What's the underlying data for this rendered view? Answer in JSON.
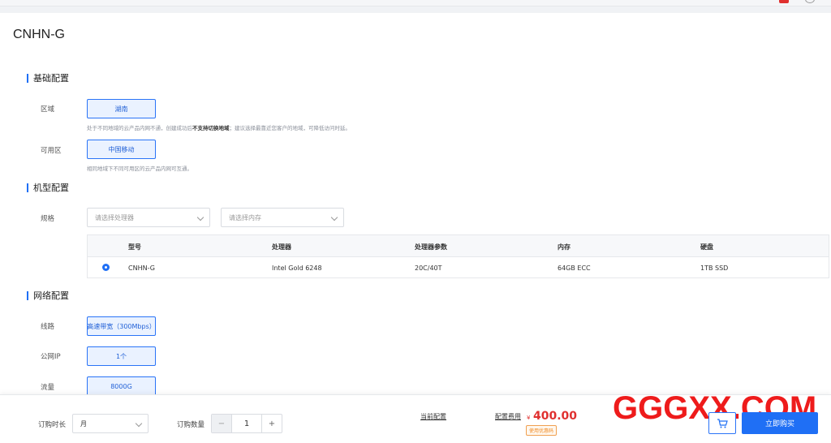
{
  "page": {
    "title": "CNHN-G"
  },
  "sections": {
    "basic": "基础配置",
    "machine": "机型配置",
    "network": "网络配置"
  },
  "region": {
    "label": "区域",
    "option": "湖南",
    "hint_pre": "处于不同地域的云产品内网不通，创建成功后",
    "hint_bold": "不支持切换地域",
    "hint_post": "；建议选择最靠近您客户的地域，可降低访问时延。"
  },
  "zone": {
    "label": "可用区",
    "option": "中国移动",
    "hint": "相同地域下不同可用区的云产品内网可互通。"
  },
  "spec": {
    "label": "规格",
    "cpu_placeholder": "请选择处理器",
    "mem_placeholder": "请选择内存"
  },
  "table": {
    "headers": [
      "型号",
      "处理器",
      "处理器参数",
      "内存",
      "硬盘"
    ],
    "rows": [
      {
        "model": "CNHN-G",
        "cpu": "Intel Gold 6248",
        "cpu_params": "20C/40T",
        "memory": "64GB ECC",
        "disk": "1TB SSD",
        "selected": true
      }
    ]
  },
  "network": {
    "line_label": "线路",
    "line_option": "高速带宽（300Mbps）",
    "ip_label": "公网IP",
    "ip_option": "1个",
    "traffic_label": "流量",
    "traffic_option": "8000G"
  },
  "footer": {
    "duration_label": "订购时长",
    "duration_value": "月",
    "quantity_label": "订购数量",
    "quantity_value": "1",
    "minus": "−",
    "plus": "+",
    "current_config": "当前配置",
    "fee_label": "配置费用",
    "currency": "¥",
    "price": "400.00",
    "coupon": "使用优惠码",
    "buy": "立即购买"
  },
  "watermark": "GGGXX.COM",
  "colors": {
    "accent": "#1f6ff5",
    "price": "#e0302f",
    "watermark": "#ee1b1b"
  },
  "icons": [
    "cart-icon",
    "chevron-down-icon"
  ]
}
